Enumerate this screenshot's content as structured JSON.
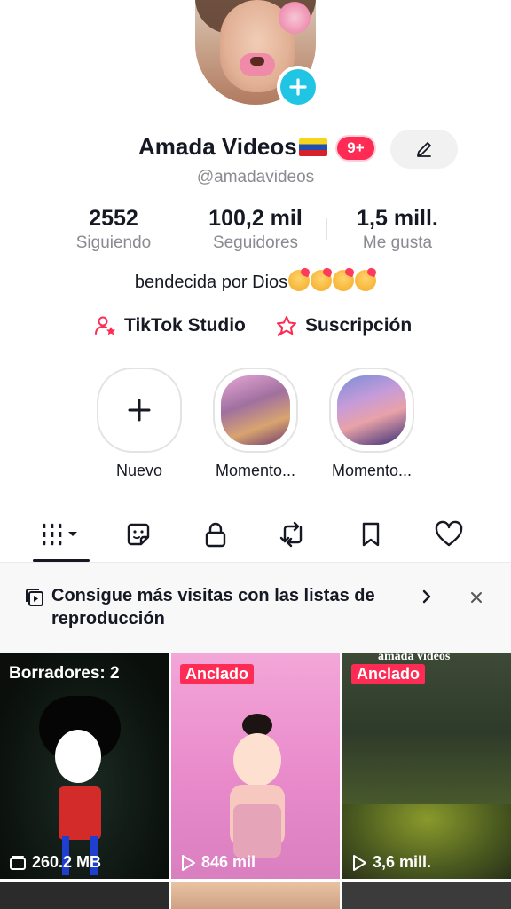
{
  "profile": {
    "name": "Amada Videos",
    "flag": "venezuela-flag",
    "notifications_badge": "9+",
    "handle": "@amadavideos",
    "bio": "bendecida por Dios",
    "bio_emoji_count": 4
  },
  "stats": [
    {
      "value": "2552",
      "label": "Siguiendo"
    },
    {
      "value": "100,2 mil",
      "label": "Seguidores"
    },
    {
      "value": "1,5 mill.",
      "label": "Me gusta"
    }
  ],
  "links": {
    "studio": "TikTok Studio",
    "subscription": "Suscripción"
  },
  "highlights": [
    {
      "label": "Nuevo"
    },
    {
      "label": "Momento..."
    },
    {
      "label": "Momento..."
    }
  ],
  "tabs": [
    "videos",
    "reposts-stickers",
    "private",
    "repost",
    "favorites",
    "liked"
  ],
  "banner": {
    "text": "Consigue más visitas con las listas de reproducción"
  },
  "grid": [
    {
      "tag": "Borradores: 2",
      "meta": "260.2 MB",
      "meta_icon": "storage-icon"
    },
    {
      "tag": "Anclado",
      "meta": "846 mil",
      "meta_icon": "play-icon"
    },
    {
      "tag": "Anclado",
      "meta": "3,6 mill.",
      "meta_icon": "play-icon",
      "watermark": "amada videos"
    }
  ],
  "colors": {
    "accent": "#fe2c55",
    "add_badge": "#20c5e4",
    "muted_text": "#8a8b91"
  }
}
